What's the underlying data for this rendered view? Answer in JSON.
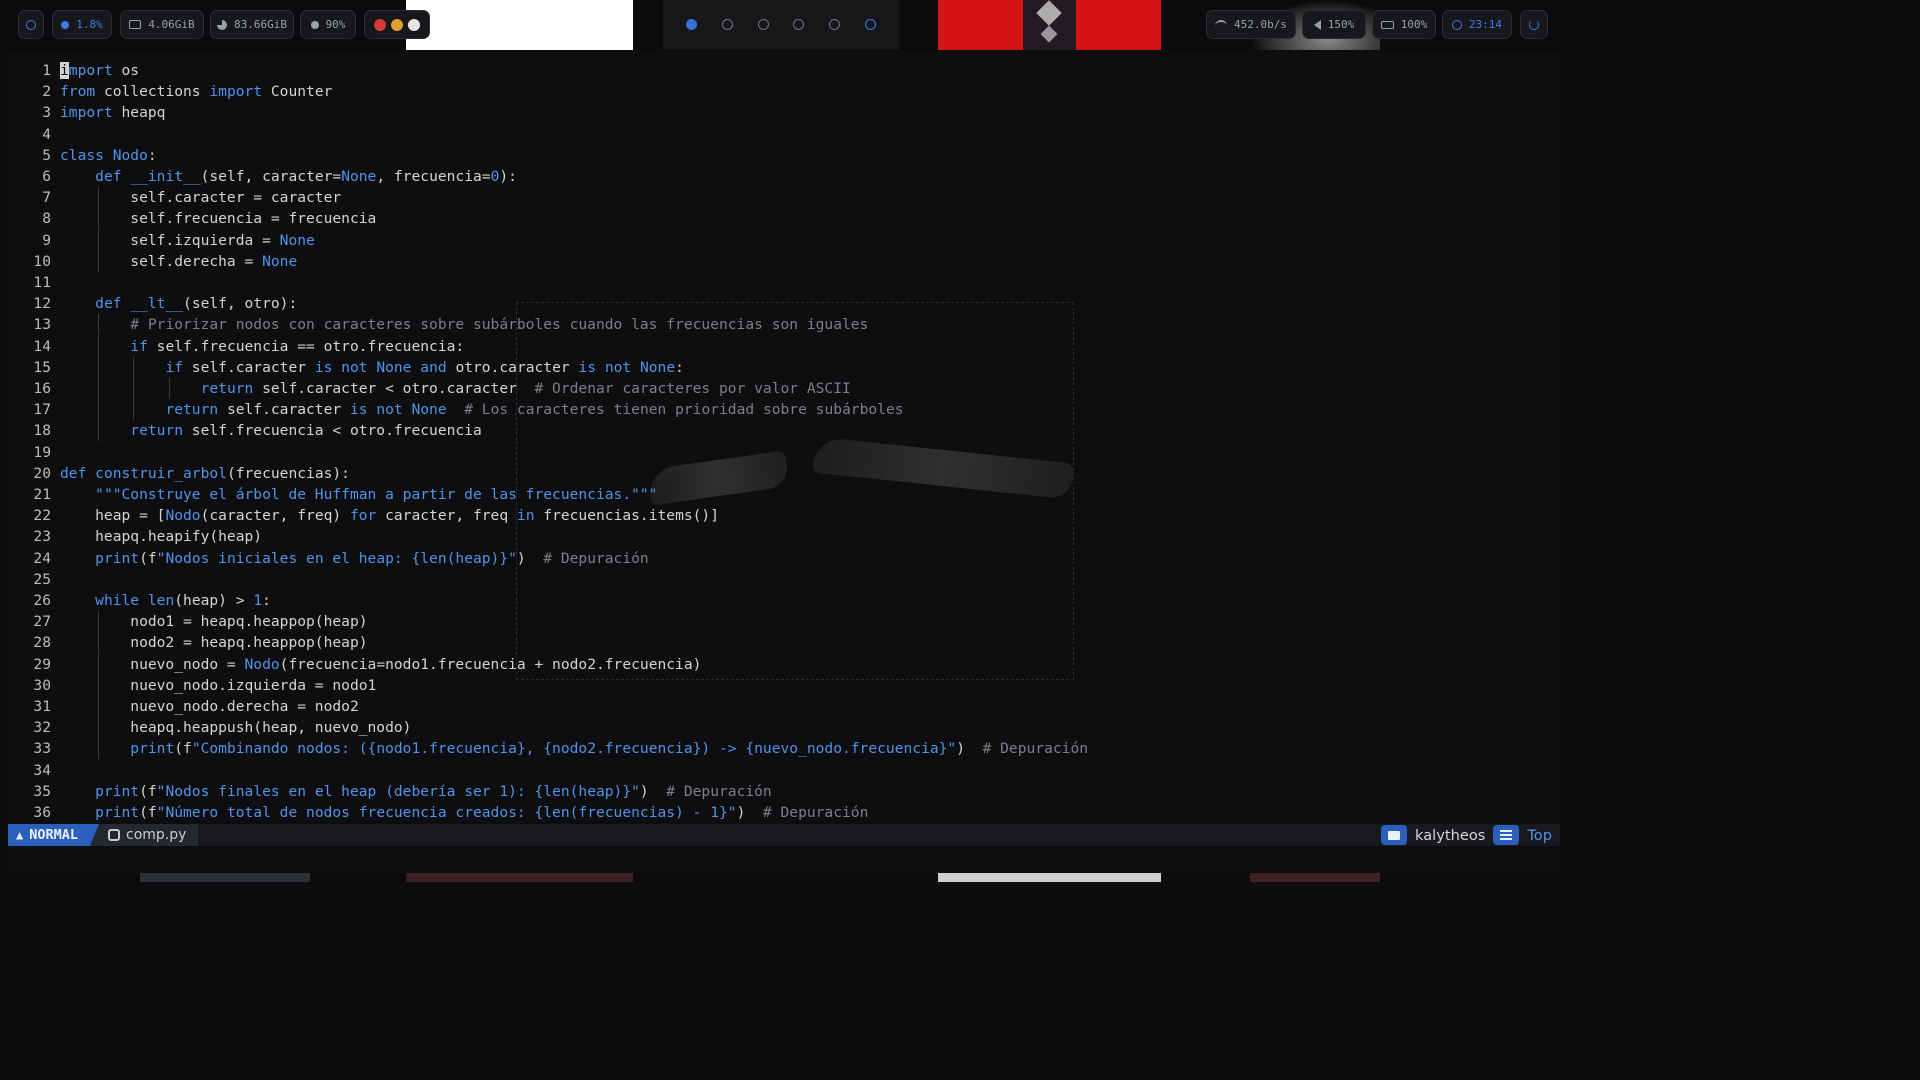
{
  "topbar": {
    "cpu": "1.8%",
    "memory": "4.06GiB",
    "disk": "83.66GiB",
    "temp": "90%",
    "network": "452.0b/s",
    "volume": "150%",
    "battery": "100%",
    "clock": "23:14"
  },
  "colors": {
    "accent": "#3d7be6",
    "keyword": "#4f94e8",
    "comment": "#7b7f86",
    "mode_bg": "#2b5fbe"
  },
  "editor": {
    "lines": [
      {
        "n": "1",
        "c": "import os"
      },
      {
        "n": "2",
        "c": "from collections import Counter"
      },
      {
        "n": "3",
        "c": "import heapq"
      },
      {
        "n": "4",
        "c": ""
      },
      {
        "n": "5",
        "c": "class Nodo:"
      },
      {
        "n": "6",
        "c": "    def __init__(self, caracter=None, frecuencia=0):"
      },
      {
        "n": "7",
        "c": "        self.caracter = caracter"
      },
      {
        "n": "8",
        "c": "        self.frecuencia = frecuencia"
      },
      {
        "n": "9",
        "c": "        self.izquierda = None"
      },
      {
        "n": "10",
        "c": "        self.derecha = None"
      },
      {
        "n": "11",
        "c": ""
      },
      {
        "n": "12",
        "c": "    def __lt__(self, otro):"
      },
      {
        "n": "13",
        "c": "        # Priorizar nodos con caracteres sobre subárboles cuando las frecuencias son iguales"
      },
      {
        "n": "14",
        "c": "        if self.frecuencia == otro.frecuencia:"
      },
      {
        "n": "15",
        "c": "            if self.caracter is not None and otro.caracter is not None:"
      },
      {
        "n": "16",
        "c": "                return self.caracter < otro.caracter  # Ordenar caracteres por valor ASCII"
      },
      {
        "n": "17",
        "c": "            return self.caracter is not None  # Los caracteres tienen prioridad sobre subárboles"
      },
      {
        "n": "18",
        "c": "        return self.frecuencia < otro.frecuencia"
      },
      {
        "n": "19",
        "c": ""
      },
      {
        "n": "20",
        "c": "def construir_arbol(frecuencias):"
      },
      {
        "n": "21",
        "c": "    \"\"\"Construye el árbol de Huffman a partir de las frecuencias.\"\"\""
      },
      {
        "n": "22",
        "c": "    heap = [Nodo(caracter, freq) for caracter, freq in frecuencias.items()]"
      },
      {
        "n": "23",
        "c": "    heapq.heapify(heap)"
      },
      {
        "n": "24",
        "c": "    print(f\"Nodos iniciales en el heap: {len(heap)}\")  # Depuración"
      },
      {
        "n": "25",
        "c": ""
      },
      {
        "n": "26",
        "c": "    while len(heap) > 1:"
      },
      {
        "n": "27",
        "c": "        nodo1 = heapq.heappop(heap)"
      },
      {
        "n": "28",
        "c": "        nodo2 = heapq.heappop(heap)"
      },
      {
        "n": "29",
        "c": "        nuevo_nodo = Nodo(frecuencia=nodo1.frecuencia + nodo2.frecuencia)"
      },
      {
        "n": "30",
        "c": "        nuevo_nodo.izquierda = nodo1"
      },
      {
        "n": "31",
        "c": "        nuevo_nodo.derecha = nodo2"
      },
      {
        "n": "32",
        "c": "        heapq.heappush(heap, nuevo_nodo)"
      },
      {
        "n": "33",
        "c": "        print(f\"Combinando nodos: ({nodo1.frecuencia}, {nodo2.frecuencia}) -> {nuevo_nodo.frecuencia}\")  # Depuración"
      },
      {
        "n": "34",
        "c": ""
      },
      {
        "n": "35",
        "c": "    print(f\"Nodos finales en el heap (debería ser 1): {len(heap)}\")  # Depuración"
      },
      {
        "n": "36",
        "c": "    print(f\"Número total de nodos frecuencia creados: {len(frecuencias) - 1}\")  # Depuración"
      }
    ]
  },
  "statusline": {
    "mode": "NORMAL",
    "filename": "comp.py",
    "user": "kalytheos",
    "position": "Top"
  }
}
